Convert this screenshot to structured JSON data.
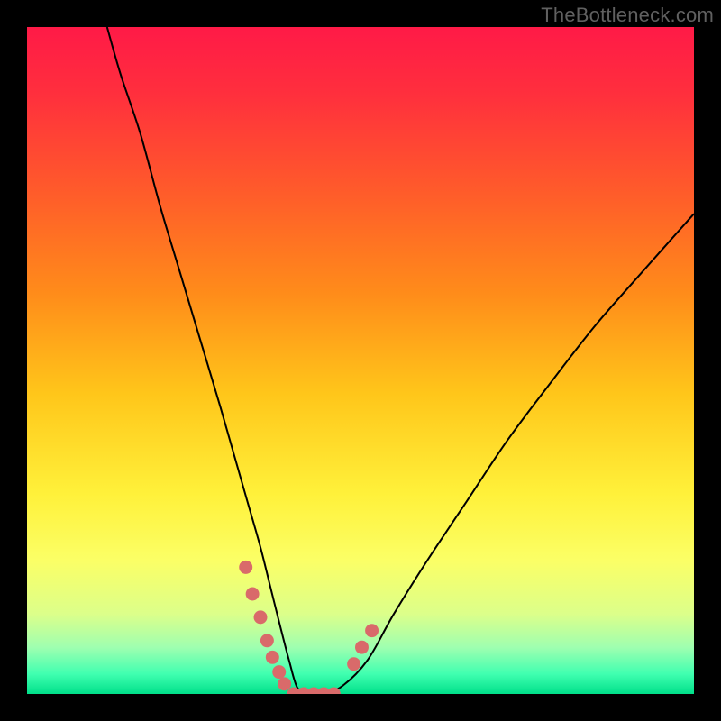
{
  "watermark": "TheBottleneck.com",
  "chart_data": {
    "type": "line",
    "title": "",
    "xlabel": "",
    "ylabel": "",
    "xlim": [
      0,
      100
    ],
    "ylim": [
      0,
      100
    ],
    "grid": false,
    "legend": false,
    "background_gradient_stops": [
      {
        "offset": 0.0,
        "color": "#ff1a47"
      },
      {
        "offset": 0.1,
        "color": "#ff2f3d"
      },
      {
        "offset": 0.25,
        "color": "#ff5c2a"
      },
      {
        "offset": 0.4,
        "color": "#ff8c1a"
      },
      {
        "offset": 0.55,
        "color": "#ffc61a"
      },
      {
        "offset": 0.7,
        "color": "#fff13a"
      },
      {
        "offset": 0.8,
        "color": "#fbff66"
      },
      {
        "offset": 0.88,
        "color": "#dcff8a"
      },
      {
        "offset": 0.93,
        "color": "#9fffb0"
      },
      {
        "offset": 0.97,
        "color": "#40ffb0"
      },
      {
        "offset": 1.0,
        "color": "#00e08a"
      }
    ],
    "series": [
      {
        "name": "curve",
        "stroke": "#000000",
        "x": [
          12,
          14,
          17,
          20,
          23,
          26,
          29,
          31,
          33,
          35,
          36.5,
          38,
          39.3,
          40.5,
          42,
          44,
          47,
          51,
          55,
          60,
          66,
          72,
          78,
          85,
          92,
          100
        ],
        "y": [
          100,
          93,
          84,
          73,
          63,
          53,
          43,
          36,
          29,
          22,
          16,
          10,
          5,
          1,
          0,
          0,
          1,
          5,
          12,
          20,
          29,
          38,
          46,
          55,
          63,
          72
        ]
      },
      {
        "name": "highlight-dots-left",
        "type": "scatter",
        "color": "#d96a6a",
        "size": 15,
        "x": [
          32.8,
          33.8,
          35.0,
          36.0,
          36.8,
          37.8,
          38.6
        ],
        "y": [
          19.0,
          15.0,
          11.5,
          8.0,
          5.5,
          3.3,
          1.5
        ]
      },
      {
        "name": "highlight-dots-bottom",
        "type": "scatter",
        "color": "#d96a6a",
        "size": 15,
        "x": [
          40.0,
          41.5,
          43.0,
          44.5,
          46.0
        ],
        "y": [
          0.0,
          0.0,
          0.0,
          0.0,
          0.0
        ]
      },
      {
        "name": "highlight-dots-right",
        "type": "scatter",
        "color": "#d96a6a",
        "size": 15,
        "x": [
          49.0,
          50.2,
          51.7
        ],
        "y": [
          4.5,
          7.0,
          9.5
        ]
      }
    ]
  }
}
